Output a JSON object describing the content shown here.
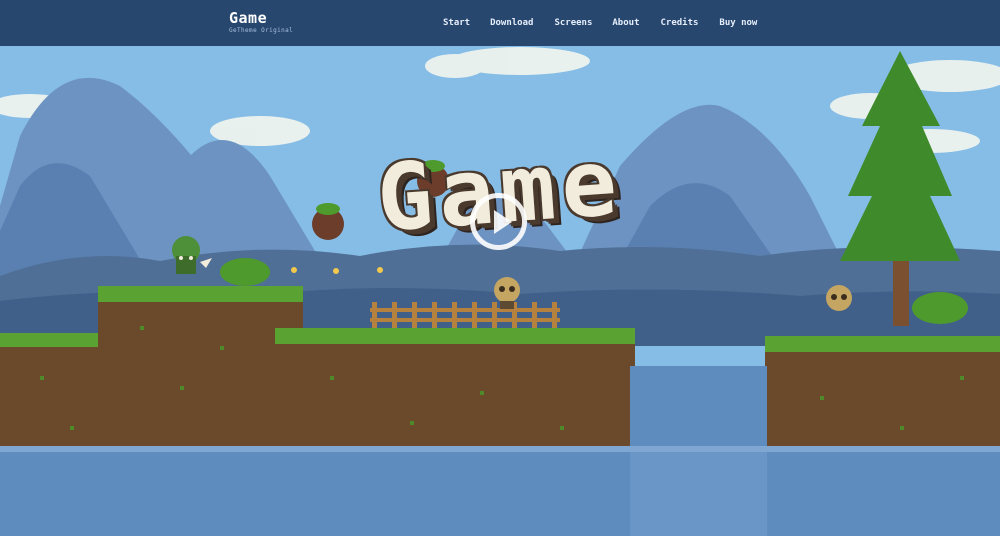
{
  "header": {
    "brand_title": "Game",
    "brand_subtitle": "GeTheme Original",
    "nav": [
      {
        "label": "Start"
      },
      {
        "label": "Download"
      },
      {
        "label": "Screens"
      },
      {
        "label": "About"
      },
      {
        "label": "Credits"
      },
      {
        "label": "Buy now"
      }
    ]
  },
  "hero": {
    "logo_text": "Game",
    "play_icon": "play-icon"
  },
  "colors": {
    "header_bg": "#27476f",
    "sky": "#7fb6e0",
    "mountain": "#6d93c2",
    "grass": "#4f9a2e",
    "dirt": "#6b4a2b",
    "water": "#5e8cbe"
  }
}
